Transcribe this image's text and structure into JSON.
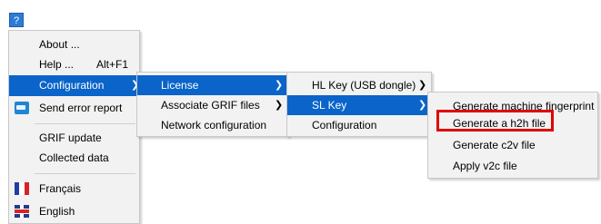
{
  "help_button": {
    "label": "?"
  },
  "main_menu": {
    "items": [
      {
        "label": "About ...",
        "accel": ""
      },
      {
        "label": "Help ...",
        "accel": "Alt+F1"
      },
      {
        "label": "Configuration",
        "accel": ""
      },
      {
        "label": "Send error report",
        "icon": "bug-report-icon"
      },
      {
        "label": "GRIF update"
      },
      {
        "label": "Collected data"
      },
      {
        "label": "Français",
        "icon": "french-flag-icon"
      },
      {
        "label": "English",
        "icon": "english-flag-icon"
      }
    ]
  },
  "config_menu": {
    "items": [
      {
        "label": "License"
      },
      {
        "label": "Associate GRIF files"
      },
      {
        "label": "Network configuration"
      }
    ]
  },
  "license_menu": {
    "items": [
      {
        "label": "HL Key (USB dongle)"
      },
      {
        "label": "SL Key"
      },
      {
        "label": "Configuration"
      }
    ]
  },
  "slkey_menu": {
    "items": [
      {
        "label": "Generate machine fingerprint"
      },
      {
        "label": "Generate a h2h file"
      },
      {
        "label": "Generate c2v file"
      },
      {
        "label": "Apply v2c file"
      }
    ]
  },
  "colors": {
    "highlight": "#0a64c9",
    "callout_box": "#e00000",
    "menu_bg": "#f2f2f2"
  }
}
